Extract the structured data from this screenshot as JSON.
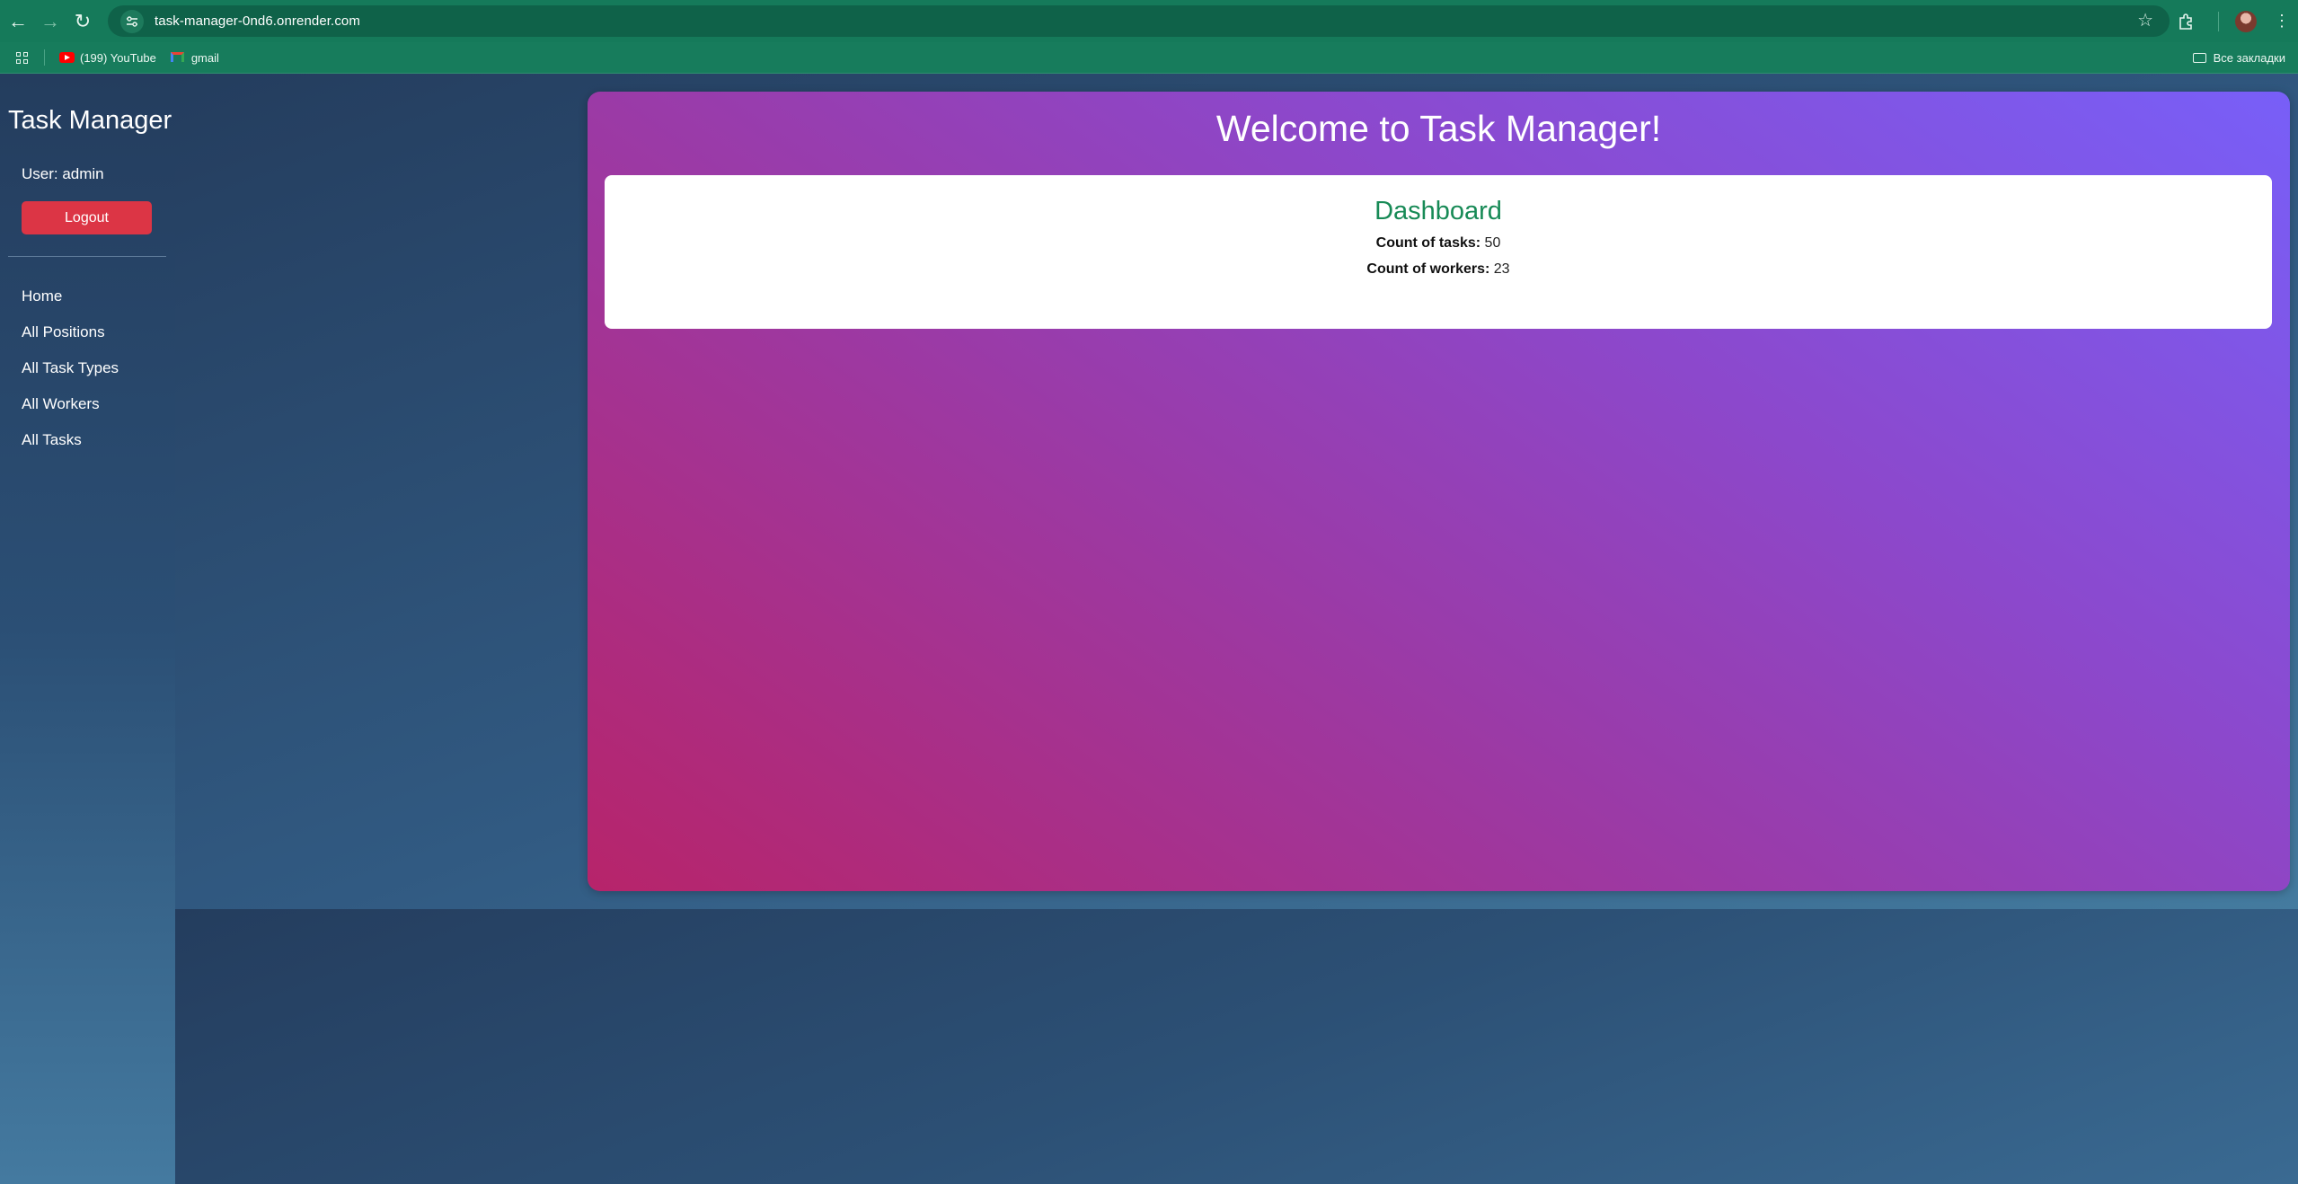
{
  "browser": {
    "url": "task-manager-0nd6.onrender.com",
    "bookmarks": [
      {
        "label": "(199) YouTube",
        "icon": "youtube-icon"
      },
      {
        "label": "gmail",
        "icon": "gmail-icon"
      }
    ],
    "all_bookmarks_label": "Все закладки"
  },
  "sidebar": {
    "brand": "Task Manager",
    "user_text": "User: admin",
    "logout_label": "Logout",
    "nav": [
      "Home",
      "All Positions",
      "All Task Types",
      "All Workers",
      "All Tasks"
    ]
  },
  "main": {
    "welcome": "Welcome to Task Manager!",
    "dashboard": {
      "title": "Dashboard",
      "tasks_label": "Count of tasks:",
      "tasks_value": "50",
      "workers_label": "Count of workers:",
      "workers_value": "23"
    }
  },
  "colors": {
    "chrome": "#157a5a",
    "logout": "#dc3545",
    "dashboard_title": "#178a56"
  }
}
